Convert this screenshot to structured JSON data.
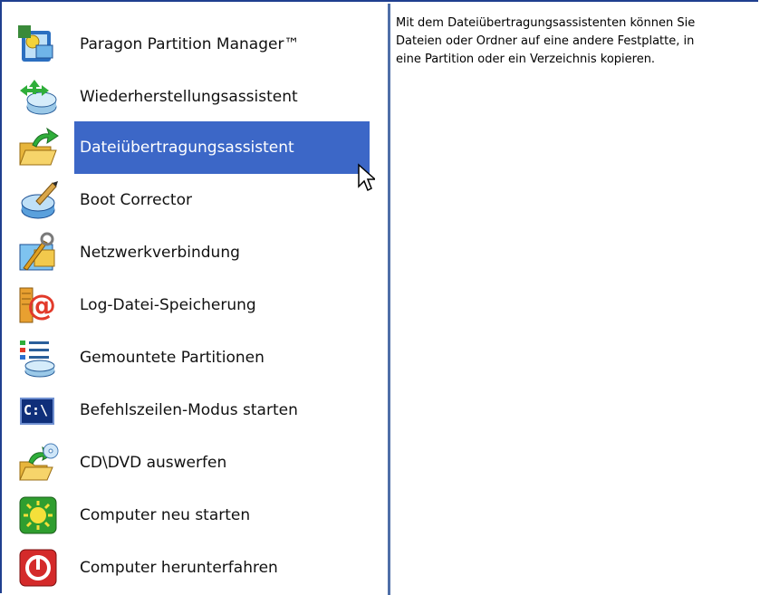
{
  "menu": {
    "items": [
      {
        "label": "Paragon Partition Manager™",
        "icon": "partition-manager-icon"
      },
      {
        "label": "Wiederherstellungsassistent",
        "icon": "restore-wizard-icon"
      },
      {
        "label": "Dateiübertragungsassistent",
        "icon": "file-transfer-icon",
        "selected": true
      },
      {
        "label": "Boot Corrector",
        "icon": "boot-corrector-icon"
      },
      {
        "label": "Netzwerkverbindung",
        "icon": "network-icon"
      },
      {
        "label": "Log-Datei-Speicherung",
        "icon": "log-save-icon"
      },
      {
        "label": "Gemountete Partitionen",
        "icon": "mounted-partitions-icon"
      },
      {
        "label": "Befehlszeilen-Modus starten",
        "icon": "command-line-icon"
      },
      {
        "label": "CD\\DVD auswerfen",
        "icon": "eject-disc-icon"
      },
      {
        "label": "Computer neu starten",
        "icon": "restart-icon"
      },
      {
        "label": "Computer herunterfahren",
        "icon": "shutdown-icon"
      }
    ],
    "cmd_icon_text": "C:\\"
  },
  "description": {
    "text": "Mit dem Dateiübertragungsassistenten können Sie Dateien oder Ordner auf eine andere Festplatte, in eine Partition oder ein Verzeichnis kopieren."
  },
  "colors": {
    "selection": "#3c67c7",
    "frame": "#1f3f8f"
  }
}
